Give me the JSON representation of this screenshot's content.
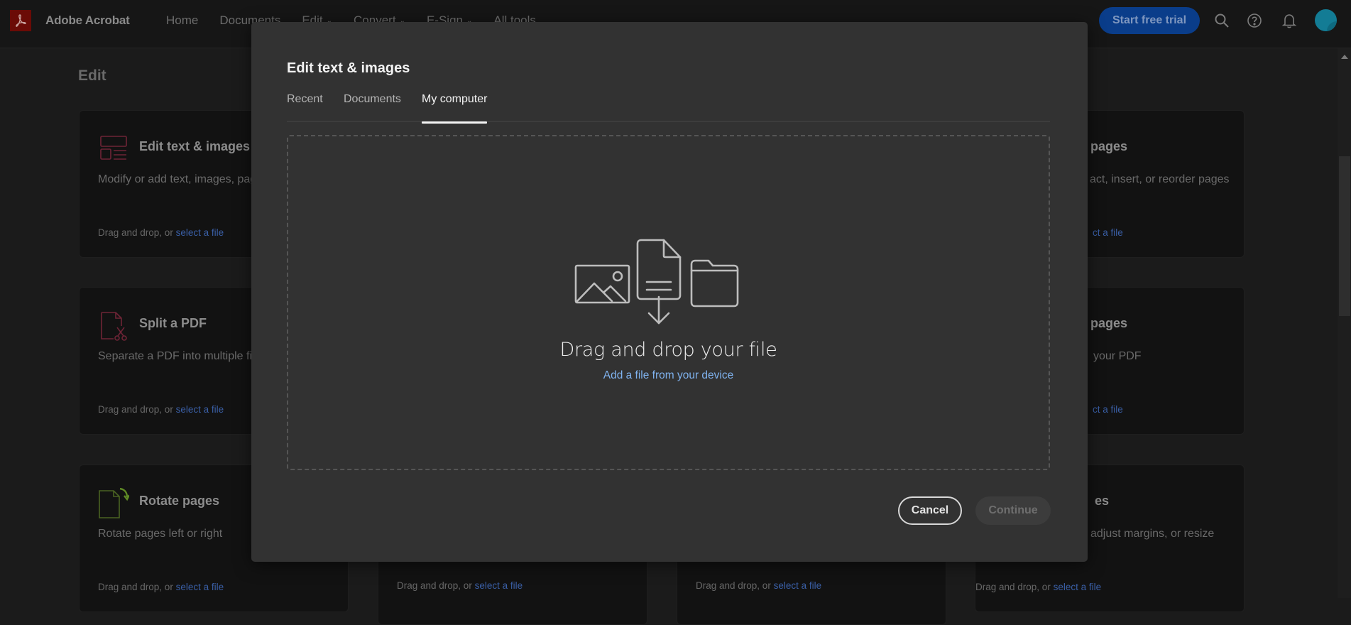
{
  "header": {
    "brand": "Adobe Acrobat",
    "nav": [
      {
        "label": "Home",
        "has_dropdown": false
      },
      {
        "label": "Documents",
        "has_dropdown": false
      },
      {
        "label": "Edit",
        "has_dropdown": true
      },
      {
        "label": "Convert",
        "has_dropdown": true
      },
      {
        "label": "E-Sign",
        "has_dropdown": true
      },
      {
        "label": "All tools",
        "has_dropdown": false
      }
    ],
    "chevron": "⌄",
    "cta_label": "Start free trial",
    "icons": [
      "search-icon",
      "help-icon",
      "bell-icon",
      "avatar"
    ]
  },
  "page": {
    "section_title": "Edit",
    "cards": [
      {
        "title": "Edit text & images",
        "desc": "Modify or add text, images, pages, and more",
        "drop": "Drag and drop, or ",
        "link": "select a file",
        "icon": "edit-text-images-icon"
      },
      {
        "title": "Split a PDF",
        "desc": "Separate a PDF into multiple files",
        "drop": "Drag and drop, or ",
        "link": "select a file",
        "icon": "split-pdf-icon"
      },
      {
        "title": "Rotate pages",
        "desc": "Rotate pages left or right",
        "drop": "Drag and drop, or ",
        "link": "select a file",
        "icon": "rotate-pages-icon"
      },
      {
        "title": "",
        "desc": "",
        "drop": "Drag and drop, or ",
        "link": "select a file"
      },
      {
        "title": "",
        "desc": "",
        "drop": "Drag and drop, or ",
        "link": "select a file"
      },
      {
        "title": "pages",
        "desc": "act, insert, or reorder pages",
        "drop": "",
        "link": "ct a file"
      },
      {
        "title": "pages",
        "desc": "your PDF",
        "drop": "",
        "link": "ct a file"
      },
      {
        "title": "es",
        "desc": "adjust margins, or resize",
        "drop": "Drag and drop, or ",
        "link": "select a file"
      }
    ]
  },
  "modal": {
    "title": "Edit text & images",
    "tabs": [
      {
        "label": "Recent",
        "active": false
      },
      {
        "label": "Documents",
        "active": false
      },
      {
        "label": "My computer",
        "active": true
      }
    ],
    "dropzone": {
      "title": "Drag and drop your file",
      "link": "Add a file from your device"
    },
    "cancel_label": "Cancel",
    "continue_label": "Continue",
    "continue_disabled": true
  },
  "colors": {
    "accent_blue": "#0a3d8a",
    "link_blue": "#7fb2ee",
    "brand_red": "#6b0b06"
  }
}
